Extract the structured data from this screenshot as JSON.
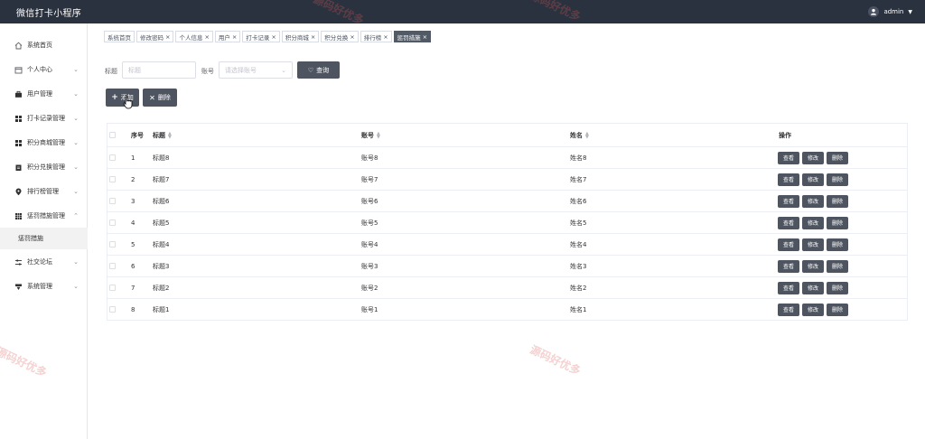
{
  "header": {
    "app_title": "微信打卡小程序",
    "username": "admin"
  },
  "sidebar": {
    "items": [
      {
        "label": "系统首页",
        "icon": "home-icon"
      },
      {
        "label": "个人中心",
        "icon": "calendar-icon"
      },
      {
        "label": "用户管理",
        "icon": "briefcase-icon"
      },
      {
        "label": "打卡记录管理",
        "icon": "grid-icon"
      },
      {
        "label": "积分商城管理",
        "icon": "grid-icon"
      },
      {
        "label": "积分兑换管理",
        "icon": "clipboard-icon"
      },
      {
        "label": "排行榜管理",
        "icon": "location-icon"
      },
      {
        "label": "惩罚措施管理",
        "icon": "grid-icon"
      },
      {
        "label": "社交论坛",
        "icon": "sliders-icon"
      },
      {
        "label": "系统管理",
        "icon": "filter-icon"
      }
    ],
    "submenu_label": "惩罚措施"
  },
  "tabs": [
    "系统首页",
    "修改密码",
    "个人信息",
    "用户",
    "打卡记录",
    "积分商城",
    "积分兑换",
    "排行榜",
    "惩罚措施"
  ],
  "search": {
    "title_label": "标题",
    "title_placeholder": "标题",
    "account_label": "账号",
    "account_placeholder": "请选择账号",
    "query_button": "查询"
  },
  "actions": {
    "add": "添加",
    "delete": "删除"
  },
  "table": {
    "headers": {
      "index": "序号",
      "title": "标题",
      "account": "账号",
      "name": "姓名",
      "ops": "操作"
    },
    "rows": [
      {
        "index": "1",
        "title": "标题8",
        "account": "账号8",
        "name": "姓名8"
      },
      {
        "index": "2",
        "title": "标题7",
        "account": "账号7",
        "name": "姓名7"
      },
      {
        "index": "3",
        "title": "标题6",
        "account": "账号6",
        "name": "姓名6"
      },
      {
        "index": "4",
        "title": "标题5",
        "account": "账号5",
        "name": "姓名5"
      },
      {
        "index": "5",
        "title": "标题4",
        "account": "账号4",
        "name": "姓名4"
      },
      {
        "index": "6",
        "title": "标题3",
        "account": "账号3",
        "name": "姓名3"
      },
      {
        "index": "7",
        "title": "标题2",
        "account": "账号2",
        "name": "姓名2"
      },
      {
        "index": "8",
        "title": "标题1",
        "account": "账号1",
        "name": "姓名1"
      }
    ],
    "op_view": "查看",
    "op_edit": "修改",
    "op_delete": "删除"
  },
  "watermark": "源码好优多",
  "colors": {
    "topbar": "#2b323f",
    "button": "#4e5561",
    "active_tab": "#525a66",
    "watermark": "#dc5a5a"
  }
}
